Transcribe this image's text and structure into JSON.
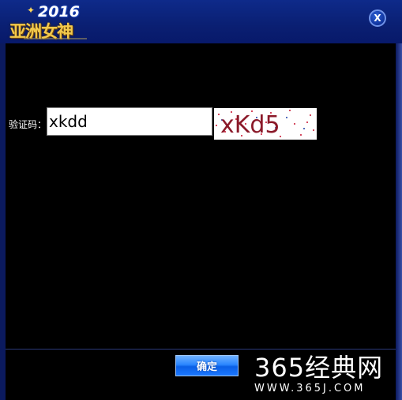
{
  "window": {
    "logo": {
      "year": "2016",
      "name": "亚洲女神"
    },
    "close_label": "X"
  },
  "form": {
    "captcha_label": "验证码：",
    "captcha_value": "xkdd",
    "captcha_image_text": "xKd5"
  },
  "footer": {
    "ok_label": "确定"
  },
  "watermark": {
    "main": "365经典网",
    "url": "WWW.365J.COM"
  },
  "colors": {
    "titlebar": "#0b1a5e",
    "content_bg": "#000000",
    "ok_button": "#2a86ff",
    "logo_gold": "#f2c94c"
  }
}
